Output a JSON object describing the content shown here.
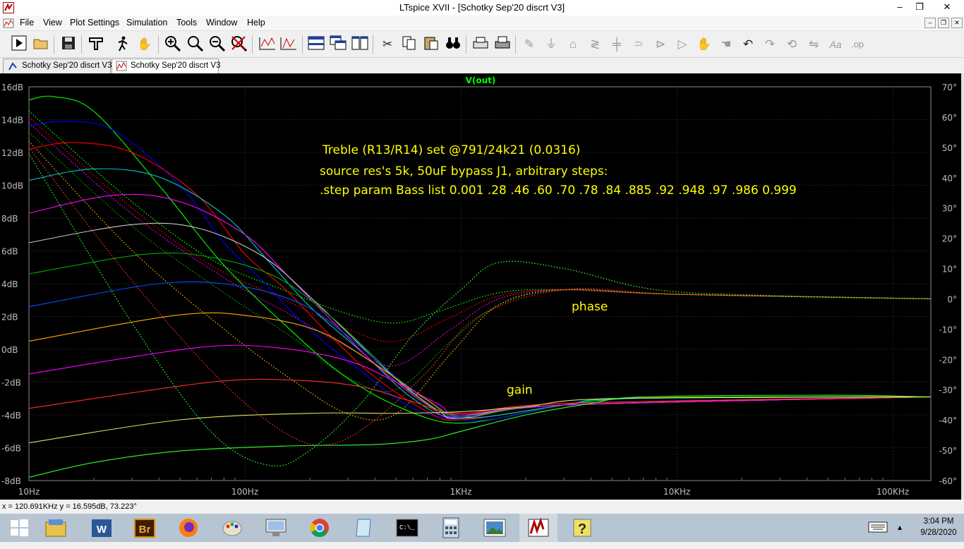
{
  "window": {
    "title": "LTspice XVII - [Schotky Sep'20 discrt V3]",
    "controls": {
      "minimize": "–",
      "maximize": "❐",
      "close": "✕"
    },
    "mdi_controls": {
      "minimize": "–",
      "restore": "❐",
      "close": "✕"
    }
  },
  "menu": [
    "File",
    "View",
    "Plot Settings",
    "Simulation",
    "Tools",
    "Window",
    "Help"
  ],
  "toolbar": {
    "icons": [
      "run-icon",
      "open-icon",
      "save-icon",
      "control-panel-icon",
      "halt-icon",
      "pan-icon",
      "zoom-in-icon",
      "zoom-area-icon",
      "zoom-out-icon",
      "zoom-cancel-icon",
      "autorange-icon",
      "add-trace-icon",
      "tile-horizontal-icon",
      "cascade-icon",
      "tile-vertical-icon",
      "cut-icon",
      "copy-icon",
      "paste-icon",
      "find-icon",
      "print-preview-icon",
      "print-icon",
      "wire-icon",
      "ground-icon",
      "label-icon",
      "resistor-icon",
      "capacitor-icon",
      "inductor-icon",
      "diode-icon",
      "component-icon",
      "move-icon",
      "drag-icon",
      "undo-icon",
      "redo-icon",
      "rotate-icon",
      "mirror-icon",
      "text-icon",
      "spice-directive-icon"
    ]
  },
  "tabs": [
    {
      "label": "Schotky Sep'20 discrt V3",
      "kind": "schematic",
      "active": false
    },
    {
      "label": "Schotky Sep'20 discrt V3",
      "kind": "waveform",
      "active": true
    }
  ],
  "plot": {
    "trace_label": "V(out)",
    "trace_label_color": "#00ff00",
    "left_ticks": [
      "16dB",
      "14dB",
      "12dB",
      "10dB",
      "8dB",
      "6dB",
      "4dB",
      "2dB",
      "0dB",
      "-2dB",
      "-4dB",
      "-6dB",
      "-8dB"
    ],
    "right_ticks": [
      "70°",
      "60°",
      "50°",
      "40°",
      "30°",
      "20°",
      "10°",
      "0°",
      "-10°",
      "-20°",
      "-30°",
      "-40°",
      "-50°",
      "-60°"
    ],
    "x_ticks": [
      "10Hz",
      "100Hz",
      "1KHz",
      "10KHz",
      "100KHz"
    ],
    "annotations": {
      "line1": "Treble (R13/R14) set @791/24k21 (0.0316)",
      "line2": "source res's 5k, 50uF bypass J1, arbitrary steps:",
      "line3": ".step param Bass list 0.001 .28 .46 .60 .70 .78 .84 .885 .92 .948 .97 .986 0.999",
      "phase": "phase",
      "gain": "gain"
    },
    "annotation_color": "#ffff00"
  },
  "chart_data": {
    "type": "line",
    "title": "V(out)",
    "x_scale": "log",
    "xlim": [
      10,
      150000
    ],
    "ylim_left": [
      -8,
      16
    ],
    "ylim_right": [
      -60,
      70
    ],
    "xlabel": "",
    "ylabel": "",
    "grid": true,
    "step_param": "Bass",
    "step_values": [
      0.001,
      0.28,
      0.46,
      0.6,
      0.7,
      0.78,
      0.84,
      0.885,
      0.92,
      0.948,
      0.97,
      0.986,
      0.999
    ],
    "series_colors": [
      "#00ff00",
      "#0000ff",
      "#ff0000",
      "#00c8c8",
      "#ff00ff",
      "#c8c8c8",
      "#00aa00",
      "#0050ff",
      "#ffaa00",
      "#ff00ff",
      "#ff3030",
      "#e0e060",
      "#30ff30"
    ],
    "gain_db": [
      {
        "bass": 0.999,
        "points": [
          [
            10,
            15.2
          ],
          [
            13,
            15.4
          ],
          [
            20,
            14.5
          ],
          [
            40,
            10.0
          ],
          [
            70,
            6.0
          ],
          [
            100,
            3.8
          ],
          [
            150,
            1.6
          ],
          [
            250,
            -1.0
          ],
          [
            400,
            -2.8
          ],
          [
            700,
            -4.2
          ],
          [
            1000,
            -4.5
          ],
          [
            1500,
            -4.2
          ],
          [
            3000,
            -3.4
          ],
          [
            6000,
            -3.0
          ],
          [
            20000,
            -2.9
          ],
          [
            150000,
            -2.9
          ]
        ]
      },
      {
        "bass": 0.986,
        "points": [
          [
            10,
            13.6
          ],
          [
            15,
            13.9
          ],
          [
            25,
            13.3
          ],
          [
            50,
            10.0
          ],
          [
            80,
            6.5
          ],
          [
            120,
            4.2
          ],
          [
            200,
            1.2
          ],
          [
            350,
            -1.4
          ],
          [
            600,
            -3.6
          ],
          [
            1000,
            -4.3
          ],
          [
            1500,
            -4.2
          ],
          [
            3000,
            -3.4
          ],
          [
            6000,
            -3.0
          ],
          [
            150000,
            -2.9
          ]
        ]
      },
      {
        "bass": 0.97,
        "points": [
          [
            10,
            12.2
          ],
          [
            16,
            12.6
          ],
          [
            30,
            12.0
          ],
          [
            60,
            9.4
          ],
          [
            100,
            5.8
          ],
          [
            150,
            3.8
          ],
          [
            250,
            0.8
          ],
          [
            400,
            -1.7
          ],
          [
            700,
            -3.8
          ],
          [
            1000,
            -4.3
          ],
          [
            3000,
            -3.4
          ],
          [
            6000,
            -3.0
          ],
          [
            150000,
            -2.9
          ]
        ]
      },
      {
        "bass": 0.948,
        "points": [
          [
            10,
            10.3
          ],
          [
            20,
            11.0
          ],
          [
            40,
            10.5
          ],
          [
            80,
            8.2
          ],
          [
            130,
            5.3
          ],
          [
            200,
            2.6
          ],
          [
            350,
            -0.2
          ],
          [
            600,
            -3.0
          ],
          [
            1000,
            -4.2
          ],
          [
            3000,
            -3.4
          ],
          [
            6000,
            -3.0
          ],
          [
            150000,
            -2.9
          ]
        ]
      },
      {
        "bass": 0.92,
        "points": [
          [
            10,
            8.3
          ],
          [
            25,
            9.4
          ],
          [
            50,
            9.0
          ],
          [
            100,
            7.0
          ],
          [
            160,
            4.4
          ],
          [
            250,
            1.8
          ],
          [
            400,
            -0.9
          ],
          [
            700,
            -3.4
          ],
          [
            1000,
            -4.2
          ],
          [
            3000,
            -3.4
          ],
          [
            150000,
            -2.9
          ]
        ]
      },
      {
        "bass": 0.885,
        "points": [
          [
            10,
            6.5
          ],
          [
            30,
            7.6
          ],
          [
            60,
            7.4
          ],
          [
            120,
            5.7
          ],
          [
            200,
            3.2
          ],
          [
            300,
            1.0
          ],
          [
            500,
            -1.8
          ],
          [
            800,
            -3.8
          ],
          [
            1000,
            -4.2
          ],
          [
            3000,
            -3.4
          ],
          [
            150000,
            -2.9
          ]
        ]
      },
      {
        "bass": 0.84,
        "points": [
          [
            10,
            4.6
          ],
          [
            35,
            5.8
          ],
          [
            70,
            5.6
          ],
          [
            140,
            4.4
          ],
          [
            250,
            2.0
          ],
          [
            400,
            -0.5
          ],
          [
            600,
            -2.7
          ],
          [
            1000,
            -4.1
          ],
          [
            3000,
            -3.4
          ],
          [
            150000,
            -2.9
          ]
        ]
      },
      {
        "bass": 0.78,
        "points": [
          [
            10,
            2.6
          ],
          [
            40,
            4.0
          ],
          [
            90,
            3.9
          ],
          [
            180,
            2.8
          ],
          [
            300,
            0.8
          ],
          [
            500,
            -1.7
          ],
          [
            800,
            -3.6
          ],
          [
            1000,
            -4.1
          ],
          [
            3000,
            -3.4
          ],
          [
            150000,
            -2.9
          ]
        ]
      },
      {
        "bass": 0.7,
        "points": [
          [
            10,
            0.5
          ],
          [
            50,
            2.1
          ],
          [
            110,
            2.0
          ],
          [
            220,
            1.1
          ],
          [
            400,
            -0.9
          ],
          [
            700,
            -3.1
          ],
          [
            1000,
            -4.0
          ],
          [
            3000,
            -3.4
          ],
          [
            150000,
            -2.9
          ]
        ]
      },
      {
        "bass": 0.6,
        "points": [
          [
            10,
            -1.5
          ],
          [
            60,
            0.1
          ],
          [
            140,
            0.1
          ],
          [
            300,
            -0.7
          ],
          [
            500,
            -2.0
          ],
          [
            800,
            -3.4
          ],
          [
            1000,
            -4.0
          ],
          [
            3000,
            -3.4
          ],
          [
            150000,
            -2.9
          ]
        ]
      },
      {
        "bass": 0.46,
        "points": [
          [
            10,
            -3.6
          ],
          [
            70,
            -2.0
          ],
          [
            180,
            -1.9
          ],
          [
            350,
            -2.3
          ],
          [
            600,
            -3.2
          ],
          [
            1000,
            -3.9
          ],
          [
            3000,
            -3.3
          ],
          [
            150000,
            -2.9
          ]
        ]
      },
      {
        "bass": 0.28,
        "points": [
          [
            10,
            -5.7
          ],
          [
            50,
            -4.3
          ],
          [
            200,
            -3.9
          ],
          [
            500,
            -3.9
          ],
          [
            1000,
            -3.8
          ],
          [
            2000,
            -3.5
          ],
          [
            5000,
            -3.0
          ],
          [
            150000,
            -2.9
          ]
        ]
      },
      {
        "bass": 0.001,
        "points": [
          [
            10,
            -7.8
          ],
          [
            20,
            -6.9
          ],
          [
            50,
            -6.2
          ],
          [
            150,
            -5.9
          ],
          [
            400,
            -5.8
          ],
          [
            700,
            -5.5
          ],
          [
            1000,
            -5.0
          ],
          [
            2000,
            -4.0
          ],
          [
            4000,
            -3.3
          ],
          [
            7000,
            -2.9
          ],
          [
            50000,
            -2.8
          ],
          [
            150000,
            -2.9
          ]
        ]
      }
    ],
    "phase_deg": [
      {
        "bass": 0.999,
        "points": [
          [
            10,
            62
          ],
          [
            30,
            32
          ],
          [
            70,
            13
          ],
          [
            150,
            3
          ],
          [
            300,
            -5
          ],
          [
            500,
            -8
          ],
          [
            800,
            -4
          ],
          [
            1500,
            2
          ],
          [
            3000,
            3
          ],
          [
            10000,
            1.5
          ],
          [
            150000,
            0
          ]
        ]
      },
      {
        "bass": 0.97,
        "points": [
          [
            10,
            60
          ],
          [
            30,
            30
          ],
          [
            70,
            11
          ],
          [
            150,
            0
          ],
          [
            300,
            -10
          ],
          [
            500,
            -14
          ],
          [
            900,
            -6
          ],
          [
            1500,
            1
          ],
          [
            3000,
            3
          ],
          [
            10000,
            1.5
          ],
          [
            150000,
            0
          ]
        ]
      },
      {
        "bass": 0.92,
        "points": [
          [
            10,
            58
          ],
          [
            30,
            28
          ],
          [
            80,
            7
          ],
          [
            160,
            -5
          ],
          [
            300,
            -16
          ],
          [
            500,
            -22
          ],
          [
            900,
            -10
          ],
          [
            1500,
            0
          ],
          [
            3000,
            3
          ],
          [
            10000,
            1.5
          ],
          [
            150000,
            0
          ]
        ]
      },
      {
        "bass": 0.84,
        "points": [
          [
            10,
            55
          ],
          [
            30,
            24
          ],
          [
            80,
            2
          ],
          [
            160,
            -12
          ],
          [
            300,
            -26
          ],
          [
            500,
            -30
          ],
          [
            900,
            -14
          ],
          [
            1500,
            -2
          ],
          [
            3000,
            3
          ],
          [
            10000,
            1.5
          ],
          [
            150000,
            0
          ]
        ]
      },
      {
        "bass": 0.7,
        "points": [
          [
            10,
            52
          ],
          [
            30,
            16
          ],
          [
            80,
            -10
          ],
          [
            160,
            -26
          ],
          [
            300,
            -38
          ],
          [
            500,
            -38
          ],
          [
            900,
            -18
          ],
          [
            1500,
            -2
          ],
          [
            3000,
            3
          ],
          [
            10000,
            1.5
          ],
          [
            150000,
            0
          ]
        ]
      },
      {
        "bass": 0.46,
        "points": [
          [
            10,
            50
          ],
          [
            30,
            6
          ],
          [
            80,
            -28
          ],
          [
            160,
            -45
          ],
          [
            250,
            -48
          ],
          [
            400,
            -40
          ],
          [
            700,
            -24
          ],
          [
            1200,
            -6
          ],
          [
            3000,
            3
          ],
          [
            10000,
            1.5
          ],
          [
            150000,
            0
          ]
        ]
      },
      {
        "bass": 0.001,
        "points": [
          [
            10,
            48
          ],
          [
            30,
            -8
          ],
          [
            70,
            -44
          ],
          [
            130,
            -55
          ],
          [
            200,
            -50
          ],
          [
            350,
            -34
          ],
          [
            600,
            -12
          ],
          [
            1000,
            3
          ],
          [
            1500,
            12
          ],
          [
            3000,
            10
          ],
          [
            8000,
            3
          ],
          [
            30000,
            1
          ],
          [
            150000,
            0
          ]
        ]
      }
    ]
  },
  "status": "x = 120.691KHz   y = 16.595dB, 73.223°",
  "taskbar": {
    "apps": [
      "start-icon",
      "file-explorer-icon",
      "word-icon",
      "bridge-icon",
      "firefox-icon",
      "paint-icon",
      "remote-desktop-icon",
      "chrome-icon",
      "notepad-icon",
      "cmd-icon",
      "calculator-icon",
      "photos-icon",
      "ltspice-icon",
      "help-icon"
    ],
    "labels": {
      "word": "W",
      "bridge": "Br",
      "cmd": "C:\\_"
    },
    "time": "3:04 PM",
    "date": "9/28/2020"
  }
}
